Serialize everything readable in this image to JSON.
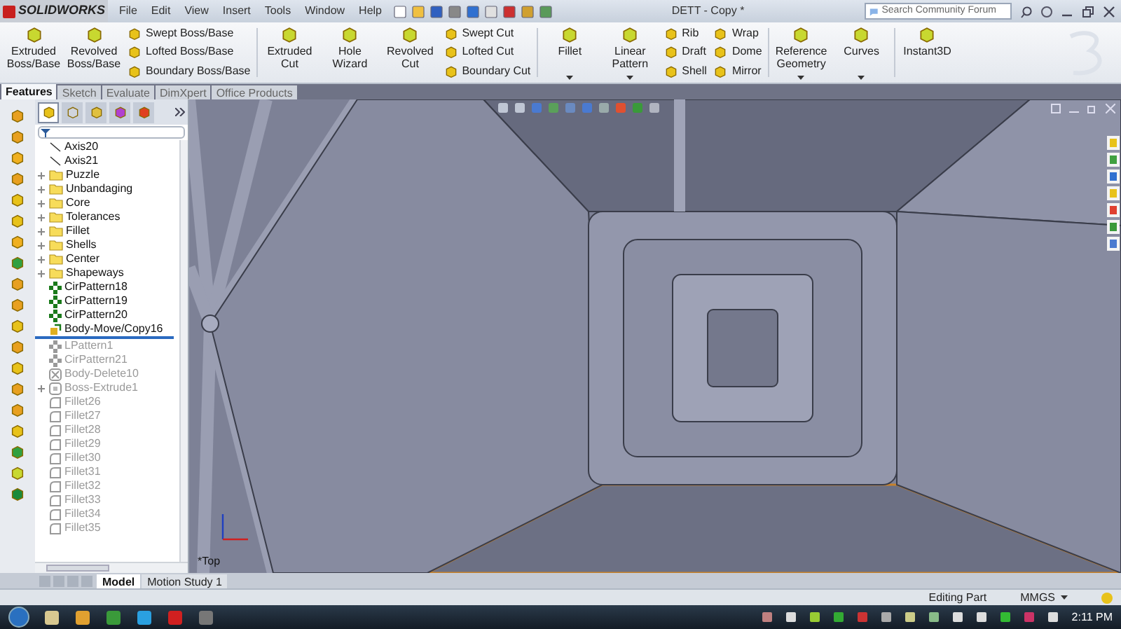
{
  "app": {
    "logo": "SOLIDWORKS",
    "menu": [
      "File",
      "Edit",
      "View",
      "Insert",
      "Tools",
      "Window",
      "Help"
    ],
    "document_title": "DETT - Copy *",
    "search": {
      "placeholder": "Search Community Forum"
    }
  },
  "ribbon": [
    {
      "kind": "large",
      "label": "Extruded Boss/Base",
      "dropdown": false
    },
    {
      "kind": "large",
      "label": "Revolved Boss/Base",
      "dropdown": false
    },
    {
      "kind": "stack",
      "items": [
        "Swept Boss/Base",
        "Lofted Boss/Base",
        "Boundary Boss/Base"
      ]
    },
    {
      "kind": "separator"
    },
    {
      "kind": "large",
      "label": "Extruded Cut",
      "dropdown": false
    },
    {
      "kind": "large",
      "label": "Hole Wizard",
      "dropdown": false
    },
    {
      "kind": "large",
      "label": "Revolved Cut",
      "dropdown": false
    },
    {
      "kind": "stack",
      "items": [
        "Swept Cut",
        "Lofted Cut",
        "Boundary Cut"
      ]
    },
    {
      "kind": "separator"
    },
    {
      "kind": "large",
      "label": "Fillet",
      "dropdown": true
    },
    {
      "kind": "large",
      "label": "Linear Pattern",
      "dropdown": true
    },
    {
      "kind": "stack",
      "items": [
        "Rib",
        "Draft",
        "Shell"
      ]
    },
    {
      "kind": "stack",
      "items": [
        "Wrap",
        "Dome",
        "Mirror"
      ]
    },
    {
      "kind": "separator"
    },
    {
      "kind": "large",
      "label": "Reference Geometry",
      "dropdown": true
    },
    {
      "kind": "large",
      "label": "Curves",
      "dropdown": true
    },
    {
      "kind": "separator"
    },
    {
      "kind": "large",
      "label": "Instant3D",
      "dropdown": false
    }
  ],
  "command_tabs": [
    {
      "label": "Features",
      "selected": true
    },
    {
      "label": "Sketch",
      "selected": false
    },
    {
      "label": "Evaluate",
      "selected": false
    },
    {
      "label": "DimXpert",
      "selected": false
    },
    {
      "label": "Office Products",
      "selected": false
    }
  ],
  "manager_tabs": [
    {
      "selected": true
    },
    {
      "selected": false
    },
    {
      "selected": false
    },
    {
      "selected": false
    },
    {
      "selected": false
    }
  ],
  "tree": [
    {
      "kind": "axis",
      "label": "Axis20",
      "expandable": false,
      "disabled": false
    },
    {
      "kind": "axis",
      "label": "Axis21",
      "expandable": false,
      "disabled": false
    },
    {
      "kind": "folder",
      "label": "Puzzle",
      "expandable": true,
      "disabled": false
    },
    {
      "kind": "folder",
      "label": "Unbandaging",
      "expandable": true,
      "disabled": false
    },
    {
      "kind": "folder",
      "label": "Core",
      "expandable": true,
      "disabled": false
    },
    {
      "kind": "folder",
      "label": "Tolerances",
      "expandable": true,
      "disabled": false
    },
    {
      "kind": "folder",
      "label": "Fillet",
      "expandable": true,
      "disabled": false
    },
    {
      "kind": "folder",
      "label": "Shells",
      "expandable": true,
      "disabled": false
    },
    {
      "kind": "folder",
      "label": "Center",
      "expandable": true,
      "disabled": false
    },
    {
      "kind": "folder",
      "label": "Shapeways",
      "expandable": true,
      "disabled": false
    },
    {
      "kind": "pattern",
      "label": "CirPattern18",
      "expandable": false,
      "disabled": false
    },
    {
      "kind": "pattern",
      "label": "CirPattern19",
      "expandable": false,
      "disabled": false
    },
    {
      "kind": "pattern",
      "label": "CirPattern20",
      "expandable": false,
      "disabled": false
    },
    {
      "kind": "move",
      "label": "Body-Move/Copy16",
      "expandable": false,
      "disabled": false
    },
    {
      "kind": "rollback"
    },
    {
      "kind": "pattern",
      "label": "LPattern1",
      "expandable": false,
      "disabled": true
    },
    {
      "kind": "pattern",
      "label": "CirPattern21",
      "expandable": false,
      "disabled": true
    },
    {
      "kind": "delete",
      "label": "Body-Delete10",
      "expandable": false,
      "disabled": true
    },
    {
      "kind": "extrude",
      "label": "Boss-Extrude1",
      "expandable": true,
      "disabled": true
    },
    {
      "kind": "fillet",
      "label": "Fillet26",
      "expandable": false,
      "disabled": true
    },
    {
      "kind": "fillet",
      "label": "Fillet27",
      "expandable": false,
      "disabled": true
    },
    {
      "kind": "fillet",
      "label": "Fillet28",
      "expandable": false,
      "disabled": true
    },
    {
      "kind": "fillet",
      "label": "Fillet29",
      "expandable": false,
      "disabled": true
    },
    {
      "kind": "fillet",
      "label": "Fillet30",
      "expandable": false,
      "disabled": true
    },
    {
      "kind": "fillet",
      "label": "Fillet31",
      "expandable": false,
      "disabled": true
    },
    {
      "kind": "fillet",
      "label": "Fillet32",
      "expandable": false,
      "disabled": true
    },
    {
      "kind": "fillet",
      "label": "Fillet33",
      "expandable": false,
      "disabled": true
    },
    {
      "kind": "fillet",
      "label": "Fillet34",
      "expandable": false,
      "disabled": true
    },
    {
      "kind": "fillet",
      "label": "Fillet35",
      "expandable": false,
      "disabled": true
    }
  ],
  "viewport": {
    "view_label": "*Top"
  },
  "bottom_tabs": [
    {
      "label": "Model",
      "selected": true
    },
    {
      "label": "Motion Study 1",
      "selected": false
    }
  ],
  "status_bar": {
    "mode": "Editing Part",
    "units": "MMGS"
  },
  "taskbar": {
    "clock": "2:11 PM"
  }
}
